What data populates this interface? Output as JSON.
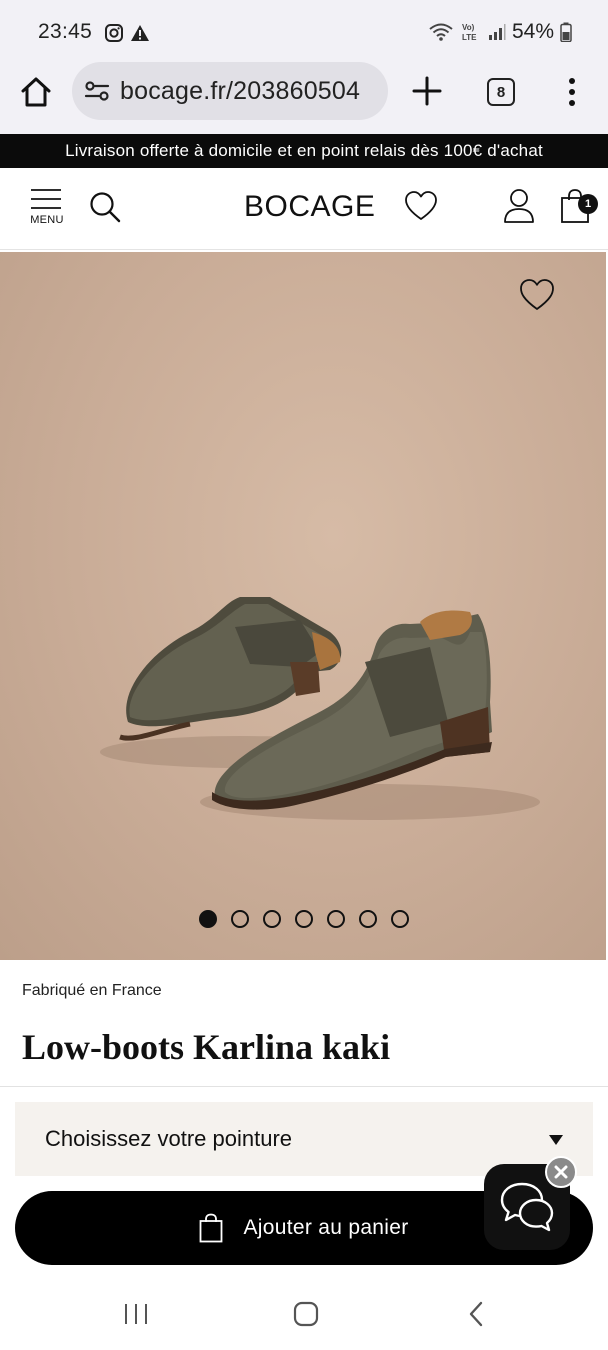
{
  "status_bar": {
    "time": "23:45",
    "battery": "54%",
    "icons": [
      "instagram-icon",
      "warning-icon",
      "wifi-icon",
      "volte-icon",
      "signal-icon",
      "battery-icon"
    ]
  },
  "browser": {
    "url": "bocage.fr/203860504",
    "tab_count": "8"
  },
  "promo": {
    "text": "Livraison offerte à domicile et en point relais dès 100€ d'achat"
  },
  "header": {
    "menu_label": "MENU",
    "logo": "BOCAGE",
    "cart_count": "1"
  },
  "gallery": {
    "total_images": 7,
    "active_index": 0
  },
  "product": {
    "origin": "Fabriqué en France",
    "title": "Low-boots Karlina kaki",
    "size_placeholder": "Choisissez votre pointure",
    "add_to_cart": "Ajouter au panier"
  },
  "colors": {
    "primary": "#000000",
    "image_bg": "#c9ac97",
    "select_bg": "#f5f2ee",
    "boot_suede": "#5e5c4c"
  }
}
